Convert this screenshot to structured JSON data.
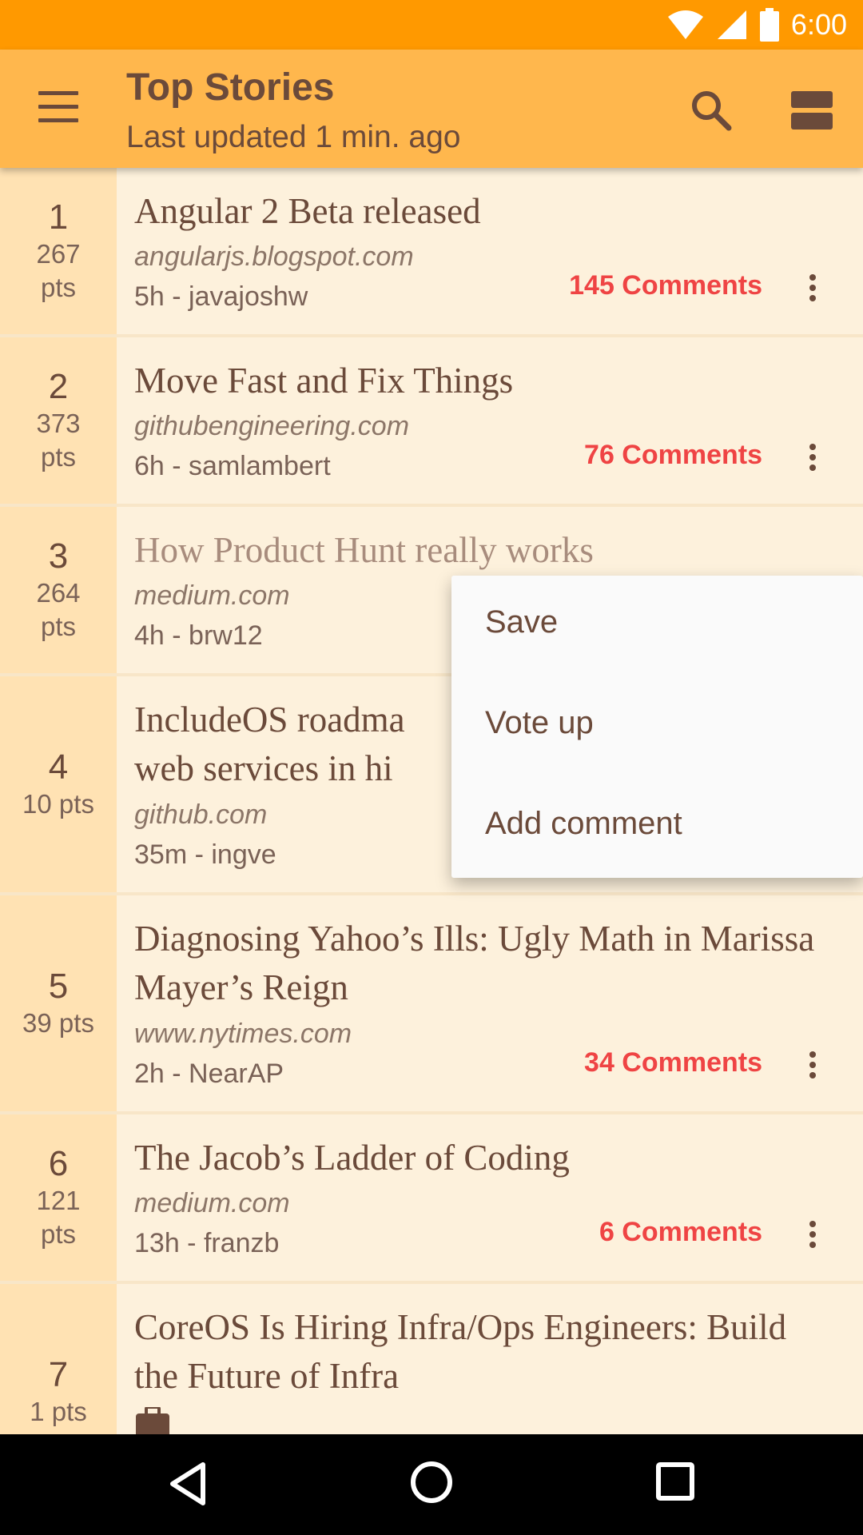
{
  "status_bar": {
    "time": "6:00",
    "icons": [
      "wifi-icon",
      "signal-icon",
      "battery-icon"
    ]
  },
  "app_bar": {
    "title": "Top Stories",
    "subtitle": "Last updated 1 min. ago",
    "icons": [
      "menu-icon",
      "search-icon",
      "view-toggle-icon"
    ]
  },
  "stories": [
    {
      "rank": "1",
      "points": "267",
      "points_unit": "pts",
      "title": "Angular 2 Beta released",
      "domain": "angularjs.blogspot.com",
      "meta": "5h - javajoshw",
      "comments": "145 Comments"
    },
    {
      "rank": "2",
      "points": "373",
      "points_unit": "pts",
      "title": "Move Fast and Fix Things",
      "domain": "githubengineering.com",
      "meta": "6h - samlambert",
      "comments": "76 Comments"
    },
    {
      "rank": "3",
      "points": "264",
      "points_unit": "pts",
      "title": "How Product Hunt really works",
      "domain": "medium.com",
      "meta": "4h - brw12",
      "comments": ""
    },
    {
      "rank": "4",
      "points": "10 pts",
      "title_line1": "IncludeOS roadma",
      "title_line2": "web services in hi",
      "domain": "github.com",
      "meta": "35m - ingve",
      "comments": ""
    },
    {
      "rank": "5",
      "points": "39 pts",
      "title": "Diagnosing Yahoo’s Ills: Ugly Math in Marissa Mayer’s Reign",
      "domain": "www.nytimes.com",
      "meta": "2h - NearAP",
      "comments": "34 Comments"
    },
    {
      "rank": "6",
      "points": "121",
      "points_unit": "pts",
      "title": "The Jacob’s Ladder of Coding",
      "domain": "medium.com",
      "meta": "13h - franzb",
      "comments": "6 Comments"
    },
    {
      "rank": "7",
      "points": "1 pts",
      "title": "CoreOS Is Hiring Infra/Ops Engineers: Build the Future of Infra",
      "domain": "",
      "meta": "",
      "comments": ""
    }
  ],
  "popup_menu": {
    "items": [
      "Save",
      "Vote up",
      "Add comment"
    ]
  },
  "colors": {
    "status_bar": "#ff9900",
    "app_bar": "#ffb74d",
    "rank_column": "#ffe2b3",
    "list_bg": "#fdf1dc",
    "comments": "#ef4444",
    "text": "#6b4a3a"
  }
}
